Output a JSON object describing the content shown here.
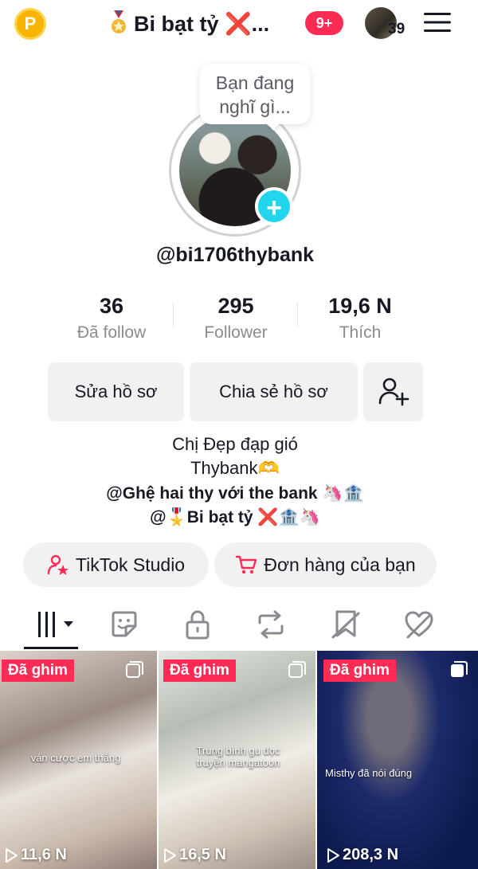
{
  "header": {
    "coin_letter": "P",
    "title": "Bi bạt tỷ ❌...",
    "notifications": "9+",
    "friends_count": "39"
  },
  "profile": {
    "bubble_text_line1": "Bạn đang",
    "bubble_text_line2": "nghĩ gì...",
    "username": "@bi1706thybank"
  },
  "stats": [
    {
      "value": "36",
      "label": "Đã follow"
    },
    {
      "value": "295",
      "label": "Follower"
    },
    {
      "value": "19,6 N",
      "label": "Thích"
    }
  ],
  "buttons": {
    "edit_profile": "Sửa hồ sơ",
    "share_profile": "Chia sẻ hồ sơ"
  },
  "bio": {
    "line1": "Chị Đẹp đạp gió",
    "line2": "Thybank🫶",
    "line3": "@Ghệ hai thy với the bank 🦄🏦",
    "line4": "@🎖️Bi bạt tỷ ❌🏦🦄"
  },
  "pills": {
    "studio": "TikTok Studio",
    "orders": "Đơn hàng của bạn"
  },
  "tabs": [
    "videos-grid",
    "stickers",
    "private-lock",
    "reposts",
    "favorites",
    "liked"
  ],
  "videos": [
    {
      "pinned": "Đã ghim",
      "caption": "ván cược em thắng",
      "views": "11,6 N"
    },
    {
      "pinned": "Đã ghim",
      "caption": "Trung bình gu đọc truyện mangatoon",
      "views": "16,5 N"
    },
    {
      "pinned": "Đã ghim",
      "caption": "Misthy đã nói đúng",
      "views": "208,3 N"
    }
  ],
  "colors": {
    "accent": "#fe2c55",
    "avatar_plus": "#20d5ec",
    "coin": "#f7b500"
  }
}
